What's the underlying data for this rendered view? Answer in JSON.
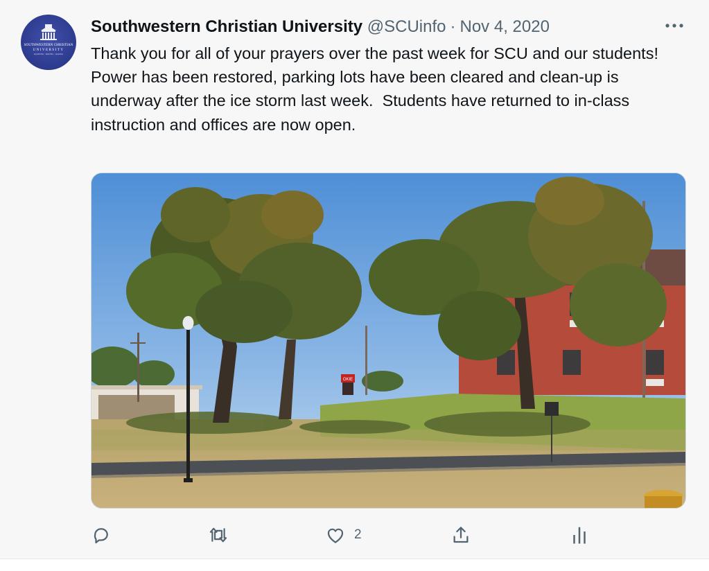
{
  "author": {
    "name": "Southwestern Christian University",
    "handle": "@SCUinfo",
    "separator": "·",
    "date": "Nov 4, 2020",
    "avatar_text": {
      "line1": "SOUTHWESTERN CHRISTIAN",
      "line2": "UNIVERSITY",
      "line3": "EQUIPPING · SERVING · LEADING"
    }
  },
  "tweet": {
    "lines": [
      "Thank you for all of your prayers over the past week for SCU and our students!",
      "Power has been restored, parking lots have been cleared and clean-up is underway after the ice storm last week.  Students have returned to in-class instruction and offices are now open."
    ],
    "image_sign": "OKIE"
  },
  "actions": {
    "reply_icon": "reply-icon",
    "retweet_icon": "retweet-icon",
    "like_icon": "heart-icon",
    "like_count": "2",
    "share_icon": "share-icon",
    "analytics_icon": "analytics-icon"
  },
  "colors": {
    "text": "#0f1419",
    "secondary": "#536471",
    "background": "#f7f7f7",
    "avatar": "#2c3b8e"
  }
}
